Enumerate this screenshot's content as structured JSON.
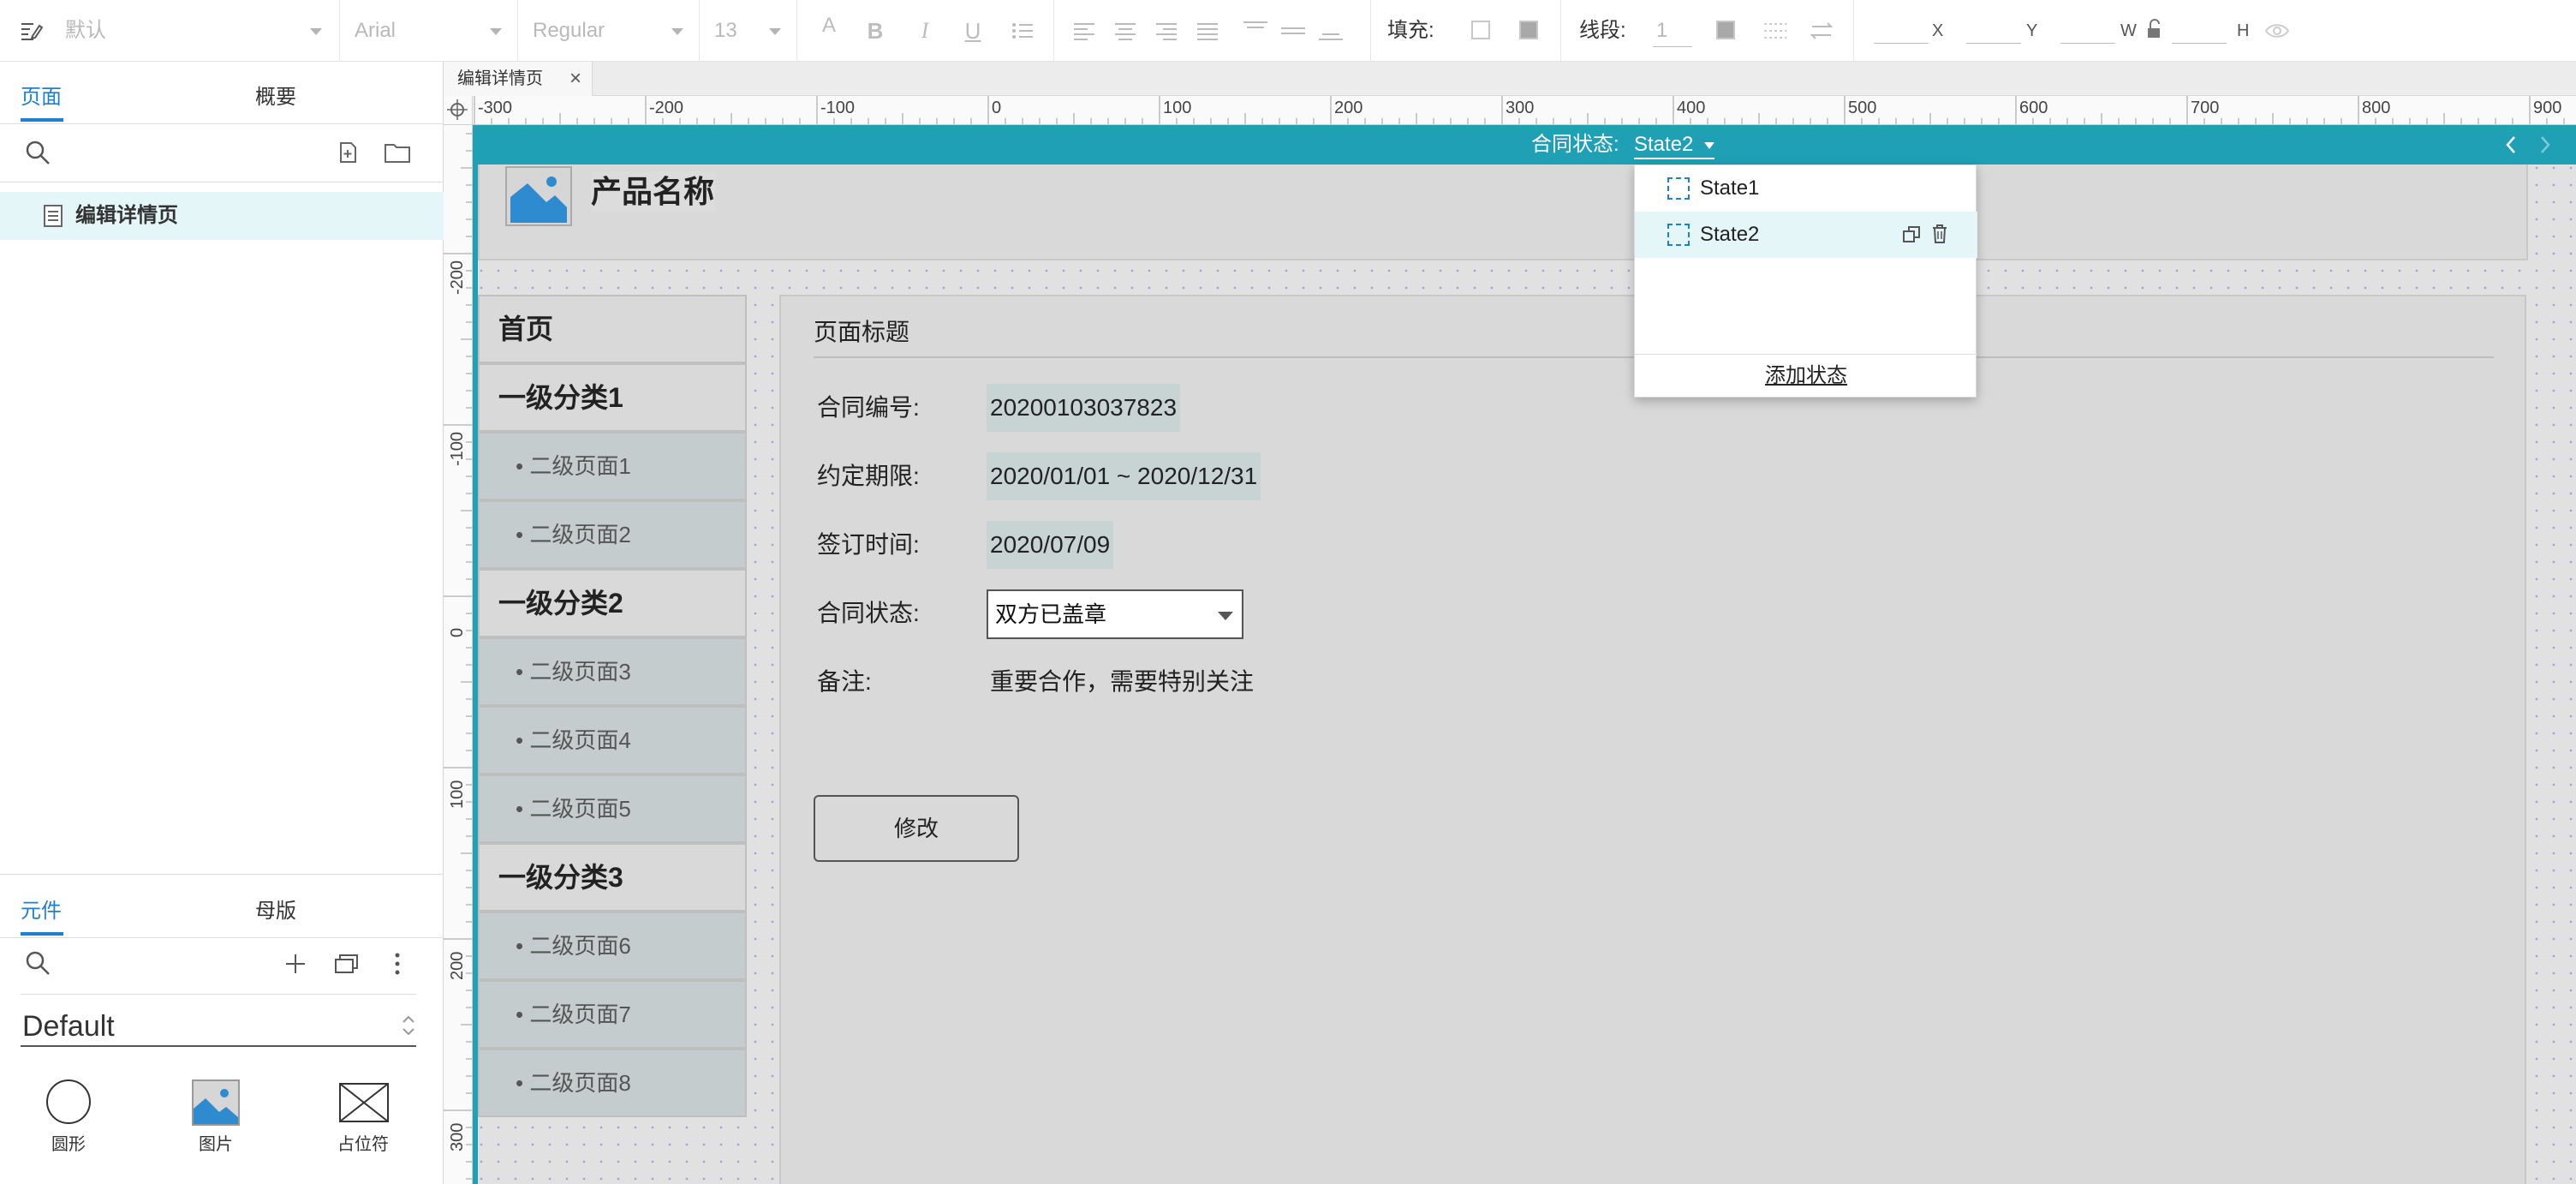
{
  "toolbar": {
    "style_select": "默认",
    "font_family": "Arial",
    "font_weight": "Regular",
    "font_size": "13",
    "fill_label": "填充:",
    "stroke_label": "线段:",
    "stroke_width": "1",
    "x_label": "X",
    "y_label": "Y",
    "w_label": "W",
    "h_label": "H"
  },
  "left_panel": {
    "tabs": [
      "页面",
      "概要"
    ],
    "pages": [
      {
        "label": "编辑详情页"
      }
    ],
    "lib_tabs": [
      "元件",
      "母版"
    ],
    "library_name": "Default",
    "widgets": [
      {
        "label": "圆形",
        "icon": "circle-icon"
      },
      {
        "label": "图片",
        "icon": "image-icon"
      },
      {
        "label": "占位符",
        "icon": "placeholder-icon"
      }
    ]
  },
  "doc_tab": {
    "label": "编辑详情页"
  },
  "rulers": {
    "h_ticks": [
      "-300",
      "-200",
      "-100",
      "0",
      "100",
      "200",
      "300",
      "400",
      "500",
      "600",
      "700",
      "800",
      "900"
    ],
    "v_ticks": [
      "-200",
      "-100",
      "0",
      "100",
      "200",
      "300"
    ]
  },
  "state_bar": {
    "label": "合同状态:",
    "current": "State2"
  },
  "state_popup": {
    "states": [
      "State1",
      "State2"
    ],
    "add_label": "添加状态"
  },
  "page": {
    "product_name": "产品名称",
    "nav": [
      {
        "label": "首页",
        "level": 1
      },
      {
        "label": "一级分类1",
        "level": 1
      },
      {
        "label": "• 二级页面1",
        "level": 2
      },
      {
        "label": "• 二级页面2",
        "level": 2
      },
      {
        "label": "一级分类2",
        "level": 1
      },
      {
        "label": "• 二级页面3",
        "level": 2
      },
      {
        "label": "• 二级页面4",
        "level": 2
      },
      {
        "label": "• 二级页面5",
        "level": 2
      },
      {
        "label": "一级分类3",
        "level": 1
      },
      {
        "label": "• 二级页面6",
        "level": 2
      },
      {
        "label": "• 二级页面7",
        "level": 2
      },
      {
        "label": "• 二级页面8",
        "level": 2
      }
    ],
    "title": "页面标题",
    "fields": {
      "contract_no_label": "合同编号:",
      "contract_no": "20200103037823",
      "period_label": "约定期限:",
      "period": "2020/01/01 ~ 2020/12/31",
      "sign_time_label": "签订时间:",
      "sign_time": "2020/07/09",
      "status_label": "合同状态:",
      "status": "双方已盖章",
      "note_label": "备注:",
      "note": "重要合作，需要特别关注"
    },
    "edit_button": "修改"
  },
  "colors": {
    "accent_blue": "#1e7fd2",
    "state_bar_teal": "#1fa0b5",
    "active_row": "#e5f6f8"
  }
}
